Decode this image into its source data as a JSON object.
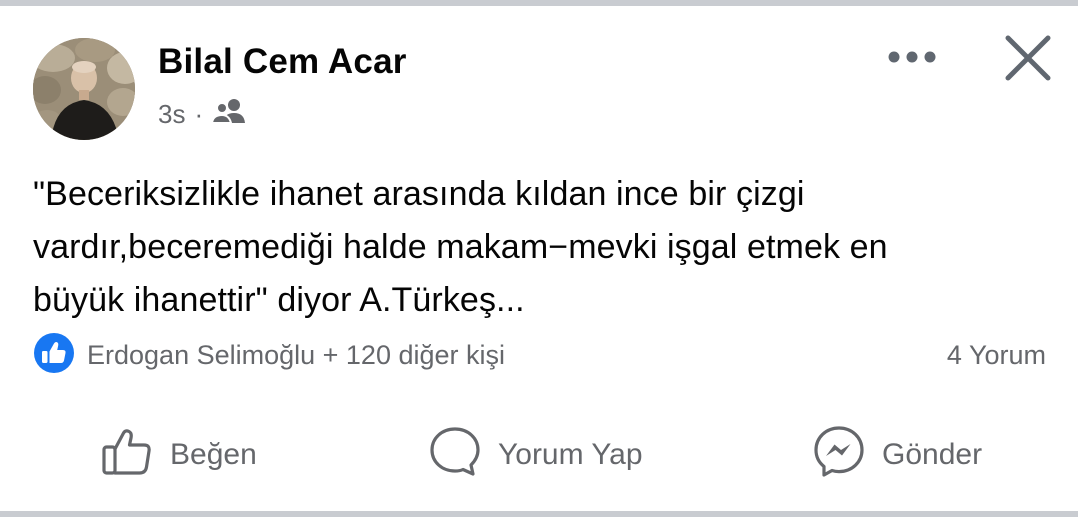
{
  "post": {
    "author": "Bilal Cem Acar",
    "time": "3s",
    "separator": "·",
    "audience_icon": "friends-icon",
    "text": "\"Beceriksizlikle ihanet arasında kıldan ince bir çizgi\nvardır,beceremediği halde makam−mevki işgal etmek en\nbüyük ihanettir\" diyor A.Türkeş...",
    "reactions": {
      "icon": "like-reaction-icon",
      "summary": "Erdogan Selimoğlu + 120 diğer kişi"
    },
    "comments_count": "4 Yorum"
  },
  "actions": {
    "like": "Beğen",
    "comment": "Yorum Yap",
    "send": "Gönder"
  },
  "colors": {
    "text_primary": "#050505",
    "text_secondary": "#65676b",
    "like_blue": "#1877f2",
    "separator": "#c9ccd1"
  }
}
